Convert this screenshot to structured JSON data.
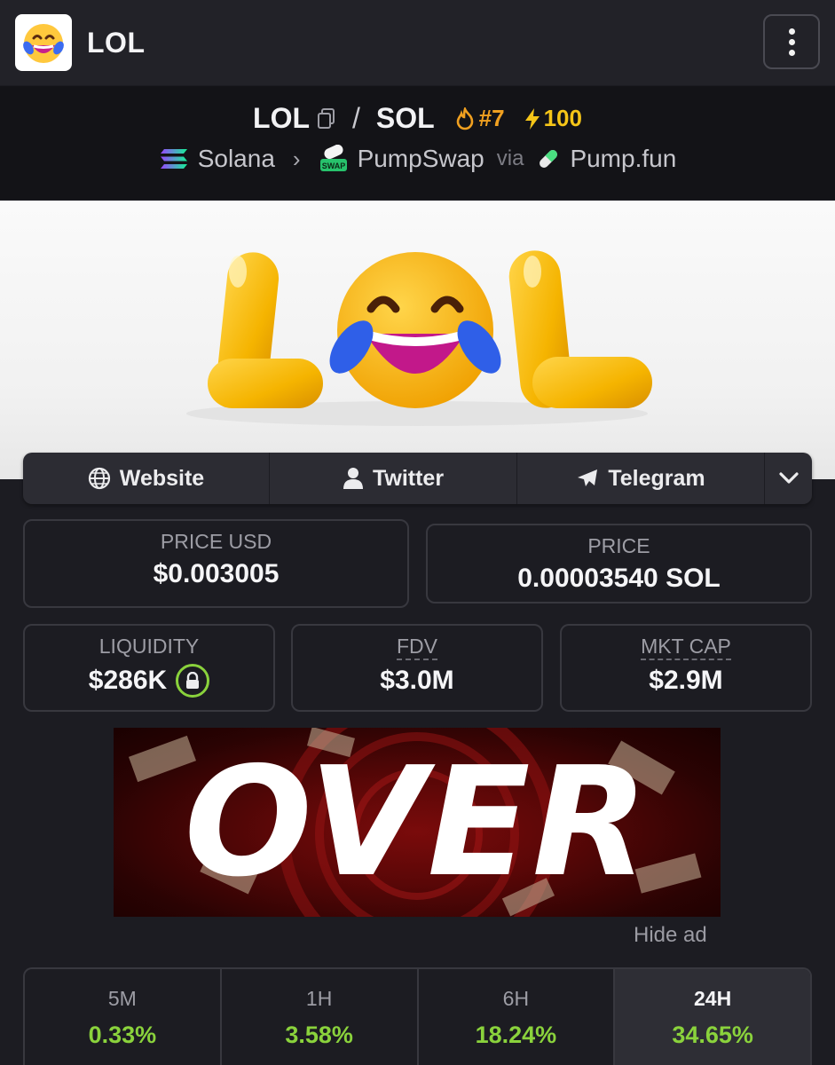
{
  "header": {
    "app_title": "LOL",
    "logo_icon": "laughing-face-emoji-icon",
    "menu_icon": "vertical-ellipsis-icon"
  },
  "pair": {
    "base": "LOL",
    "separator": "/",
    "quote": "SOL",
    "rank": "#7",
    "boost": "100",
    "chain": "Solana",
    "dex": "PumpSwap",
    "via_label": "via",
    "launchpad": "Pump.fun"
  },
  "banner": {
    "brand_text_left": "L",
    "brand_text_right": "L"
  },
  "links": {
    "website": "Website",
    "twitter": "Twitter",
    "telegram": "Telegram"
  },
  "stats": {
    "price_usd_label": "PRICE USD",
    "price_usd": "$0.003005",
    "price_label": "PRICE",
    "price_native": "0.00003540 SOL",
    "liquidity_label": "LIQUIDITY",
    "liquidity": "$286K",
    "fdv_label": "FDV",
    "fdv": "$3.0M",
    "mktcap_label": "MKT CAP",
    "mktcap": "$2.9M"
  },
  "ad": {
    "headline": "OVER",
    "hide_label": "Hide ad"
  },
  "changes": [
    {
      "period": "5M",
      "value": "0.33%"
    },
    {
      "period": "1H",
      "value": "3.58%"
    },
    {
      "period": "6H",
      "value": "18.24%"
    },
    {
      "period": "24H",
      "value": "34.65%"
    }
  ],
  "colors": {
    "positive": "#8ad23c",
    "rank": "#f0a020",
    "boost": "#f5c518",
    "background": "#1c1c22"
  }
}
